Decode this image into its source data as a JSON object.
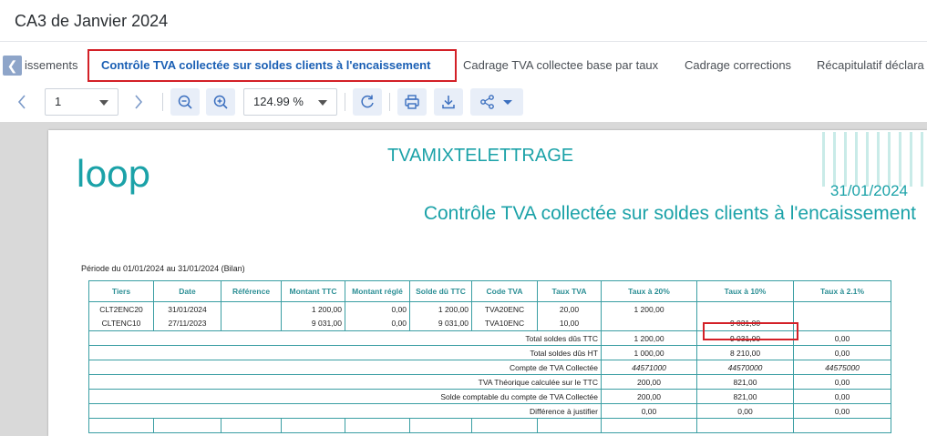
{
  "header": {
    "title": "CA3 de Janvier 2024"
  },
  "tabs": [
    {
      "label": "issements"
    },
    {
      "label": "Contrôle TVA collectée sur soldes clients à l'encaissement",
      "active": true
    },
    {
      "label": "Cadrage TVA collectee base par taux"
    },
    {
      "label": "Cadrage corrections"
    },
    {
      "label": "Récapitulatif déclara"
    }
  ],
  "toolbar": {
    "page_value": "1",
    "zoom_value": "124.99 %"
  },
  "icons": {
    "tab_scroll_left": "chevron-left-icon",
    "prev_page": "chevron-left-icon",
    "next_page": "chevron-right-icon",
    "zoom_out": "zoom-out-icon",
    "zoom_in": "zoom-in-icon",
    "refresh": "refresh-icon",
    "print": "printer-icon",
    "download": "download-icon",
    "share": "share-icon"
  },
  "document": {
    "logo": "loop",
    "company": "TVAMIXTELETTRAGE",
    "date": "31/01/2024",
    "title": "Contrôle TVA collectée sur soldes clients à l'encaissement",
    "period": "Période du 01/01/2024 au 31/01/2024 (Bilan)",
    "table": {
      "headers": [
        "Tiers",
        "Date",
        "Référence",
        "Montant TTC",
        "Montant réglé",
        "Solde dû TTC",
        "Code TVA",
        "Taux TVA",
        "Taux à 20%",
        "Taux à 10%",
        "Taux à 2.1%"
      ],
      "rows": [
        [
          "CLT2ENC20",
          "31/01/2024",
          "",
          "1 200,00",
          "0,00",
          "1 200,00",
          "TVA20ENC",
          "20,00",
          "1 200,00",
          "",
          ""
        ],
        [
          "CLTENC10",
          "27/11/2023",
          "",
          "9 031,00",
          "0,00",
          "9 031,00",
          "TVA10ENC",
          "10,00",
          "",
          "9 031,00",
          ""
        ]
      ],
      "summary": [
        {
          "label": "Total soldes dûs TTC",
          "values": [
            "1 200,00",
            "9 031,00",
            "0,00"
          ]
        },
        {
          "label": "Total soldes dûs HT",
          "values": [
            "1 000,00",
            "8 210,00",
            "0,00"
          ]
        },
        {
          "label": "Compte de TVA Collectée",
          "values": [
            "44571000",
            "44570000",
            "44575000"
          ]
        },
        {
          "label": "TVA Théorique calculée sur le TTC",
          "values": [
            "200,00",
            "821,00",
            "0,00"
          ]
        },
        {
          "label": "Solde comptable du compte de TVA Collectée",
          "values": [
            "200,00",
            "821,00",
            "0,00"
          ]
        },
        {
          "label": "Différence à justifier",
          "values": [
            "0,00",
            "0,00",
            "0,00"
          ]
        }
      ]
    }
  },
  "colors": {
    "accent": "#1a5fb4",
    "teal": "#1ba2a8",
    "highlight": "#d32027"
  }
}
